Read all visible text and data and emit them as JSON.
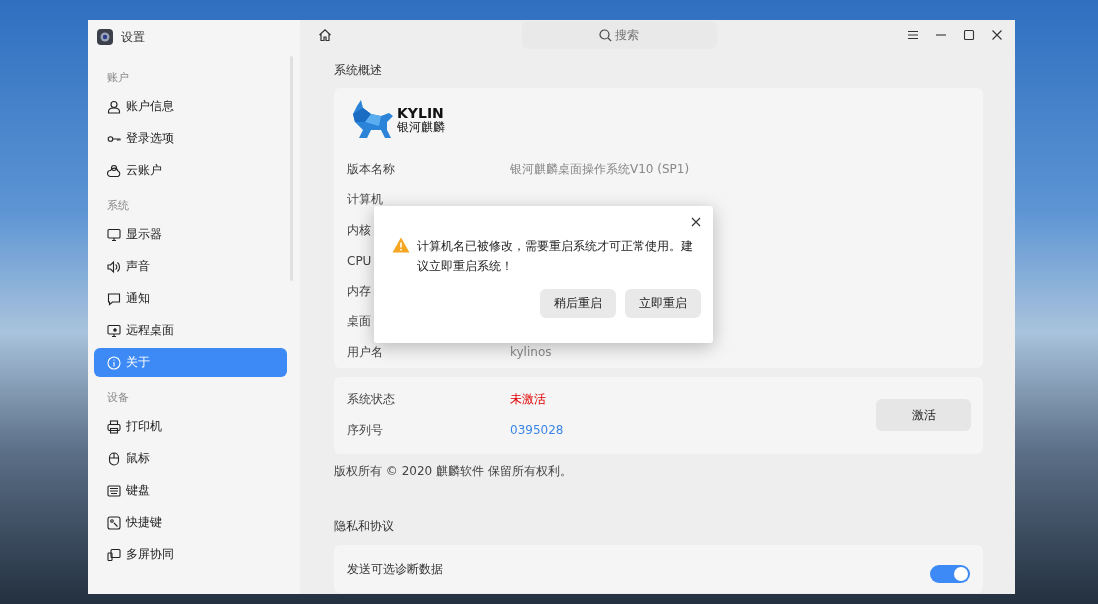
{
  "window": {
    "title": "设置"
  },
  "sidebar": {
    "groups": [
      {
        "label": "账户",
        "items": [
          {
            "label": "账户信息",
            "selected": false
          },
          {
            "label": "登录选项",
            "selected": false
          },
          {
            "label": "云账户",
            "selected": false
          }
        ]
      },
      {
        "label": "系统",
        "items": [
          {
            "label": "显示器",
            "selected": false
          },
          {
            "label": "声音",
            "selected": false
          },
          {
            "label": "通知",
            "selected": false
          },
          {
            "label": "远程桌面",
            "selected": false
          },
          {
            "label": "关于",
            "selected": true
          }
        ]
      },
      {
        "label": "设备",
        "items": [
          {
            "label": "打印机",
            "selected": false
          },
          {
            "label": "鼠标",
            "selected": false
          },
          {
            "label": "键盘",
            "selected": false
          },
          {
            "label": "快捷键",
            "selected": false
          },
          {
            "label": "多屏协同",
            "selected": false
          }
        ]
      }
    ]
  },
  "search": {
    "placeholder": "搜索"
  },
  "overview": {
    "title": "系统概述",
    "logo": {
      "wordmark": "KYLIN",
      "subtitle": "银河麒麟"
    },
    "rows": [
      {
        "label": "版本名称",
        "value": "银河麒麟桌面操作系统V10 (SP1)"
      },
      {
        "label": "计算机"
      },
      {
        "label": "内核"
      },
      {
        "label": "CPU"
      },
      {
        "label": "内存"
      },
      {
        "label": "桌面"
      },
      {
        "label": "用户名",
        "value": "kylinos"
      }
    ]
  },
  "activation": {
    "rows": [
      {
        "label": "系统状态",
        "value": "未激活",
        "kind": "warning"
      },
      {
        "label": "序列号",
        "value": "0395028",
        "kind": "link"
      }
    ],
    "button": "激活"
  },
  "copyright": "版权所有 © 2020 麒麟软件 保留所有权利。",
  "privacy": {
    "title": "隐私和协议",
    "items": [
      {
        "label": "发送可选诊断数据",
        "on": true
      }
    ]
  },
  "dialog": {
    "message": "计算机名已被修改，需要重启系统才可正常使用。建议立即重启系统！",
    "buttons": [
      "稍后重启",
      "立即重启"
    ]
  }
}
